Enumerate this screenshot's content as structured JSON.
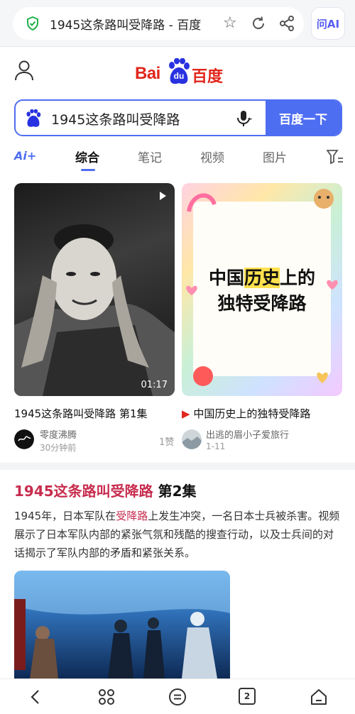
{
  "browser": {
    "url_text": "1945这条路叫受降路 - 百度",
    "ask_ai_label": "问AI"
  },
  "logo": {
    "latin": "Bai",
    "mark": "du",
    "chinese": "百度"
  },
  "search": {
    "query": "1945这条路叫受降路",
    "button_label": "百度一下"
  },
  "tabs": {
    "ai": "Ai+",
    "items": [
      "综合",
      "笔记",
      "视频",
      "图片"
    ],
    "active": "综合"
  },
  "cards": [
    {
      "title": "1945这条路叫受降路 第1集",
      "author": "零度沸腾",
      "time": "30分钟前",
      "likes": "1赞",
      "duration": "01:17"
    },
    {
      "title": "中国历史上的独特受降路",
      "overlay_line1_pre": "中国",
      "overlay_line1_hl": "历史",
      "overlay_line1_post": "上的",
      "overlay_line2": "独特受降路",
      "author": "出逃的眉小子爱旅行",
      "time": "1-11"
    }
  ],
  "result2": {
    "title_em": "1945这条路叫受降路",
    "title_rest": " 第2集",
    "desc_pre": "1945年，日本军队在",
    "desc_em": "受降路",
    "desc_post": "上发生冲突，一名日本士兵被杀害。视频展示了日本军队内部的紧张气氛和残酷的搜查行动，以及士兵间的对话揭示了军队内部的矛盾和紧张关系。"
  },
  "bottom_bar": {
    "tab_count": "2"
  },
  "colors": {
    "brand_red": "#e1261c",
    "brand_blue": "#4e6ef2",
    "keyword_red": "#c72c4e"
  }
}
